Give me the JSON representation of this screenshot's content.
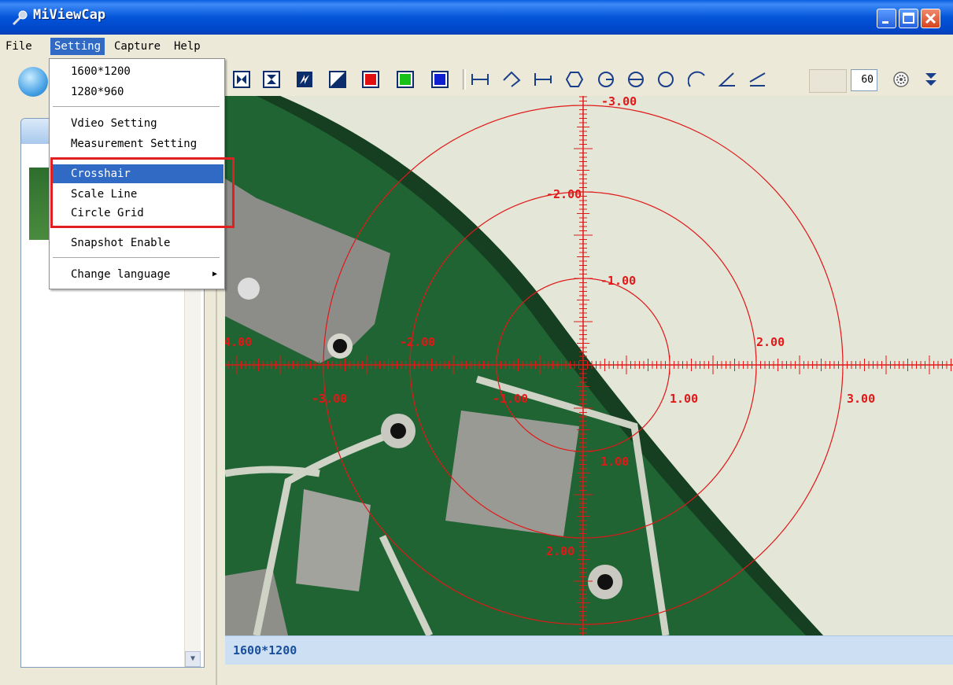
{
  "window": {
    "title": "MiViewCap"
  },
  "menubar": {
    "items": [
      "File",
      "Setting",
      "Capture",
      "Help"
    ]
  },
  "setting_menu": {
    "items": [
      {
        "label": "1600*1200"
      },
      {
        "label": "1280*960"
      },
      {
        "label": "Vdieo Setting"
      },
      {
        "label": "Measurement Setting"
      },
      {
        "label": "Crosshair",
        "selected": true
      },
      {
        "label": "Scale Line"
      },
      {
        "label": "Circle Grid"
      },
      {
        "label": "Snapshot Enable"
      },
      {
        "label": "Change language",
        "has_submenu": true
      }
    ]
  },
  "toolbar": {
    "line_width_value": "60",
    "tools": [
      "fit-window-icon",
      "center-icon",
      "flip-icon",
      "contrast-icon",
      "red-color-icon",
      "green-color-icon",
      "blue-color-icon",
      "line-measure-icon",
      "polyline-icon",
      "perpendicular-icon",
      "polygon-icon",
      "circle-center-icon",
      "circle-diameter-icon",
      "circle-three-point-icon",
      "arc-icon",
      "angle-icon",
      "angle-two-line-icon",
      "settings-icon",
      "expand-icon"
    ],
    "colors": {
      "red": "#e01010",
      "green": "#18c018",
      "blue": "#1020d0"
    }
  },
  "overlay": {
    "labels": [
      "-3.00",
      "-2.00",
      "-1.00",
      "4.00",
      "-2.00",
      "2.00",
      "-3.00",
      "-1.00",
      "1.00",
      "3.00",
      "1.00",
      "2.00"
    ],
    "color": "#e01818"
  },
  "status": {
    "resolution": "1600*1200"
  }
}
